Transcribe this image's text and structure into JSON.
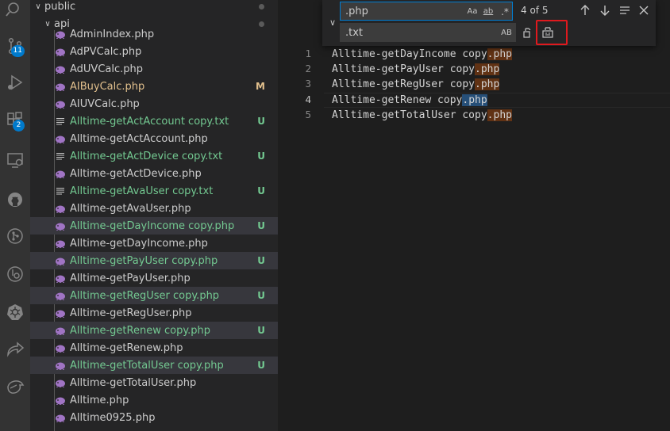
{
  "activity_bar": {
    "items": [
      {
        "name": "search-icon",
        "badge": ""
      },
      {
        "name": "source-control-icon",
        "badge": "11"
      },
      {
        "name": "run-debug-icon",
        "badge": ""
      },
      {
        "name": "extensions-icon",
        "badge": "2"
      },
      {
        "name": "remote-explorer-icon",
        "badge": ""
      },
      {
        "name": "github-icon",
        "badge": ""
      },
      {
        "name": "git-graph-icon",
        "badge": ""
      },
      {
        "name": "git-lens-icon",
        "badge": ""
      },
      {
        "name": "kubernetes-icon",
        "badge": ""
      },
      {
        "name": "live-share-icon",
        "badge": ""
      },
      {
        "name": "bird-icon",
        "badge": ""
      }
    ]
  },
  "explorer": {
    "folders": [
      {
        "label": "public",
        "expanded": true
      },
      {
        "label": "api",
        "expanded": true
      }
    ],
    "files": [
      {
        "label": "AdminIndex.php",
        "type": "php",
        "status": "",
        "color": "#cccccc",
        "selected": false
      },
      {
        "label": "AdPVCalc.php",
        "type": "php",
        "status": "",
        "color": "#cccccc",
        "selected": false
      },
      {
        "label": "AdUVCalc.php",
        "type": "php",
        "status": "",
        "color": "#cccccc",
        "selected": false
      },
      {
        "label": "AIBuyCalc.php",
        "type": "php",
        "status": "M",
        "color": "#e2c08d",
        "selected": false
      },
      {
        "label": "AIUVCalc.php",
        "type": "php",
        "status": "",
        "color": "#cccccc",
        "selected": false
      },
      {
        "label": "Alltime-getActAccount copy.txt",
        "type": "txt",
        "status": "U",
        "color": "#73c991",
        "selected": false
      },
      {
        "label": "Alltime-getActAccount.php",
        "type": "php",
        "status": "",
        "color": "#cccccc",
        "selected": false
      },
      {
        "label": "Alltime-getActDevice copy.txt",
        "type": "txt",
        "status": "U",
        "color": "#73c991",
        "selected": false
      },
      {
        "label": "Alltime-getActDevice.php",
        "type": "php",
        "status": "",
        "color": "#cccccc",
        "selected": false
      },
      {
        "label": "Alltime-getAvaUser copy.txt",
        "type": "txt",
        "status": "U",
        "color": "#73c991",
        "selected": false
      },
      {
        "label": "Alltime-getAvaUser.php",
        "type": "php",
        "status": "",
        "color": "#cccccc",
        "selected": false
      },
      {
        "label": "Alltime-getDayIncome copy.php",
        "type": "php",
        "status": "U",
        "color": "#73c991",
        "selected": true
      },
      {
        "label": "Alltime-getDayIncome.php",
        "type": "php",
        "status": "",
        "color": "#cccccc",
        "selected": false
      },
      {
        "label": "Alltime-getPayUser copy.php",
        "type": "php",
        "status": "U",
        "color": "#73c991",
        "selected": true
      },
      {
        "label": "Alltime-getPayUser.php",
        "type": "php",
        "status": "",
        "color": "#cccccc",
        "selected": false
      },
      {
        "label": "Alltime-getRegUser copy.php",
        "type": "php",
        "status": "U",
        "color": "#73c991",
        "selected": true
      },
      {
        "label": "Alltime-getRegUser.php",
        "type": "php",
        "status": "",
        "color": "#cccccc",
        "selected": false
      },
      {
        "label": "Alltime-getRenew copy.php",
        "type": "php",
        "status": "U",
        "color": "#73c991",
        "selected": true
      },
      {
        "label": "Alltime-getRenew.php",
        "type": "php",
        "status": "",
        "color": "#cccccc",
        "selected": false
      },
      {
        "label": "Alltime-getTotalUser copy.php",
        "type": "php",
        "status": "U",
        "color": "#73c991",
        "selected": true
      },
      {
        "label": "Alltime-getTotalUser.php",
        "type": "php",
        "status": "",
        "color": "#cccccc",
        "selected": false
      },
      {
        "label": "Alltime.php",
        "type": "php",
        "status": "",
        "color": "#cccccc",
        "selected": false
      },
      {
        "label": "Alltime0925.php",
        "type": "php",
        "status": "",
        "color": "#cccccc",
        "selected": false
      }
    ]
  },
  "find_widget": {
    "find_value": ".php",
    "replace_value": ".txt",
    "match_case_label": "Aa",
    "whole_word_label": "ab",
    "regex_label": ".*",
    "preserve_case_label": "AB",
    "match_count": "4 of 5"
  },
  "editor": {
    "current_line": 4,
    "lines": [
      {
        "num": "1",
        "base": "Alltime-getDayIncome copy",
        "match": ".php"
      },
      {
        "num": "2",
        "base": "Alltime-getPayUser copy",
        "match": ".php"
      },
      {
        "num": "3",
        "base": "Alltime-getRegUser copy",
        "match": ".php"
      },
      {
        "num": "4",
        "base": "Alltime-getRenew copy",
        "match": ".php"
      },
      {
        "num": "5",
        "base": "Alltime-getTotalUser copy",
        "match": ".php"
      }
    ]
  },
  "colors": {
    "accent": "#007acc",
    "untracked": "#73c991",
    "modified": "#e2c08d",
    "php_icon": "#a074c4",
    "highlight_box": "#e0191e"
  }
}
